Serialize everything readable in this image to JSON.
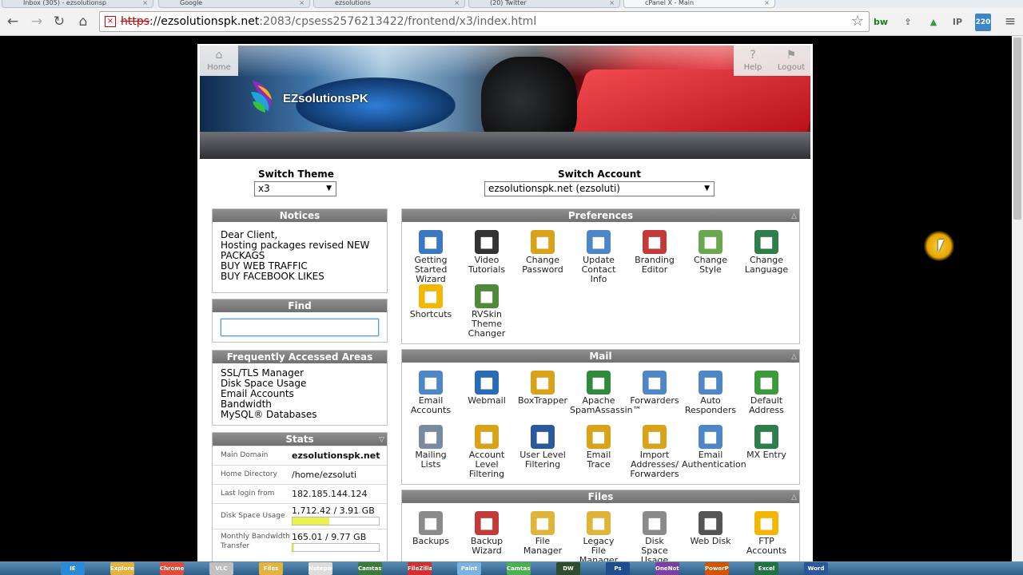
{
  "browser": {
    "tabs": [
      {
        "label": "Inbox (305) - ezsolutionsp"
      },
      {
        "label": "Google"
      },
      {
        "label": "ezsolutions"
      },
      {
        "label": "(20) Twitter"
      },
      {
        "label": "cPanel X - Main"
      }
    ],
    "url_scheme": "https",
    "url_host": "ezsolutionspk.net",
    "url_path": ":2083/cpsess2576213422/frontend/x3/index.html",
    "extensions": [
      "bw",
      "IP",
      "220"
    ]
  },
  "header": {
    "brand": "EZsolutionsPK",
    "home_label": "Home",
    "help_label": "Help",
    "logout_label": "Logout"
  },
  "switch_theme": {
    "label": "Switch Theme",
    "value": "x3"
  },
  "switch_account": {
    "label": "Switch Account",
    "value": "ezsolutionspk.net (ezsoluti)"
  },
  "notices": {
    "title": "Notices",
    "lines": [
      "Dear Client,",
      "Hosting packages revised NEW",
      "PACKAGS",
      "BUY WEB TRAFFIC",
      "BUY FACEBOOK LIKES"
    ]
  },
  "find": {
    "title": "Find",
    "value": ""
  },
  "frequent": {
    "title": "Frequently Accessed Areas",
    "links": [
      "SSL/TLS Manager",
      "Disk Space Usage",
      "Email Accounts",
      "Bandwidth",
      "MySQL® Databases"
    ]
  },
  "stats": {
    "title": "Stats",
    "main_domain_label": "Main Domain",
    "main_domain": "ezsolutionspk.net",
    "home_dir_label": "Home Directory",
    "home_dir": "/home/ezsoluti",
    "last_login_label": "Last login from",
    "last_login": "182.185.144.124",
    "disk_label": "Disk Space Usage",
    "disk": "1,712.42 / 3.91 GB",
    "disk_fraction": 0.43,
    "bw_label_1": "Monthly Bandwidth",
    "bw_label_2": "Transfer",
    "bw": "165.01 / 9.77 GB",
    "bw_fraction": 0.02
  },
  "preferences": {
    "title": "Preferences",
    "items": [
      {
        "l1": "Getting",
        "l2": "Started",
        "l3": "Wizard",
        "icon": "play-icon",
        "color": "#3a78c2"
      },
      {
        "l1": "Video",
        "l2": "Tutorials",
        "l3": "",
        "icon": "clapper-icon",
        "color": "#333333"
      },
      {
        "l1": "Change",
        "l2": "Password",
        "l3": "",
        "icon": "key-lock-icon",
        "color": "#d9a21b"
      },
      {
        "l1": "Update",
        "l2": "Contact",
        "l3": "Info",
        "icon": "contact-icon",
        "color": "#4d86c6"
      },
      {
        "l1": "Branding",
        "l2": "Editor",
        "l3": "",
        "icon": "palette-icon",
        "color": "#c23a3a"
      },
      {
        "l1": "Change",
        "l2": "Style",
        "l3": "",
        "icon": "style-icon",
        "color": "#6aa84f"
      },
      {
        "l1": "Change",
        "l2": "Language",
        "l3": "",
        "icon": "language-icon",
        "color": "#2f7d4a"
      },
      {
        "l1": "Shortcuts",
        "l2": "",
        "l3": "",
        "icon": "star-icon",
        "color": "#f2b705"
      },
      {
        "l1": "RVSkin",
        "l2": "Theme",
        "l3": "Changer",
        "icon": "theme-icon",
        "color": "#4e8a3a"
      }
    ]
  },
  "mail": {
    "title": "Mail",
    "items": [
      {
        "l1": "Email",
        "l2": "Accounts",
        "l3": "",
        "icon": "envelope-icon",
        "color": "#4f86c6"
      },
      {
        "l1": "Webmail",
        "l2": "",
        "l3": "",
        "icon": "globe-mail-icon",
        "color": "#2a6bb5"
      },
      {
        "l1": "BoxTrapper",
        "l2": "",
        "l3": "",
        "icon": "trap-icon",
        "color": "#d9a21b"
      },
      {
        "l1": "Apache",
        "l2": "SpamAssassin™",
        "l3": "",
        "icon": "spamassassin-icon",
        "color": "#2f8a3c"
      },
      {
        "l1": "Forwarders",
        "l2": "",
        "l3": "",
        "icon": "forward-icon",
        "color": "#4f86c6"
      },
      {
        "l1": "Auto",
        "l2": "Responders",
        "l3": "",
        "icon": "responder-icon",
        "color": "#4f86c6"
      },
      {
        "l1": "Default",
        "l2": "Address",
        "l3": "",
        "icon": "default-address-icon",
        "color": "#3c9a3c"
      },
      {
        "l1": "Mailing",
        "l2": "Lists",
        "l3": "",
        "icon": "mailing-list-icon",
        "color": "#7a8aa0"
      },
      {
        "l1": "Account",
        "l2": "Level",
        "l3": "Filtering",
        "icon": "filter-icon",
        "color": "#d9a21b"
      },
      {
        "l1": "User Level",
        "l2": "Filtering",
        "l3": "",
        "icon": "user-filter-icon",
        "color": "#2a5a9a"
      },
      {
        "l1": "Email",
        "l2": "Trace",
        "l3": "",
        "icon": "trace-icon",
        "color": "#d9a21b"
      },
      {
        "l1": "Import",
        "l2": "Addresses/",
        "l3": "Forwarders",
        "icon": "import-icon",
        "color": "#d9a21b"
      },
      {
        "l1": "Email",
        "l2": "Authentication",
        "l3": "",
        "icon": "auth-icon",
        "color": "#4f86c6"
      },
      {
        "l1": "MX Entry",
        "l2": "",
        "l3": "",
        "icon": "mx-icon",
        "color": "#2f7d4a"
      }
    ]
  },
  "files": {
    "title": "Files",
    "items": [
      {
        "l1": "Backups",
        "l2": "",
        "l3": "",
        "icon": "disk-icon",
        "color": "#8a8a8a"
      },
      {
        "l1": "Backup",
        "l2": "Wizard",
        "l3": "",
        "icon": "backup-wizard-icon",
        "color": "#c23a3a"
      },
      {
        "l1": "File",
        "l2": "Manager",
        "l3": "",
        "icon": "folder-icon",
        "color": "#e0b43a"
      },
      {
        "l1": "Legacy",
        "l2": "File",
        "l3": "Manager",
        "icon": "legacy-folder-icon",
        "color": "#e0b43a"
      },
      {
        "l1": "Disk",
        "l2": "Space",
        "l3": "Usage",
        "icon": "disk-usage-icon",
        "color": "#8a8a8a"
      },
      {
        "l1": "Web Disk",
        "l2": "",
        "l3": "",
        "icon": "web-disk-icon",
        "color": "#555555"
      },
      {
        "l1": "FTP",
        "l2": "Accounts",
        "l3": "",
        "icon": "ftp-icon",
        "color": "#f2b705"
      }
    ]
  },
  "taskbar": {
    "apps": [
      "IE",
      "Explorer",
      "Chrome",
      "VLC",
      "Files",
      "Notepad",
      "Camtasia",
      "FileZilla",
      "Paint",
      "Camtasia Studio",
      "DW",
      "Ps",
      "OneNote",
      "PowerPoint",
      "Excel",
      "Word"
    ]
  }
}
